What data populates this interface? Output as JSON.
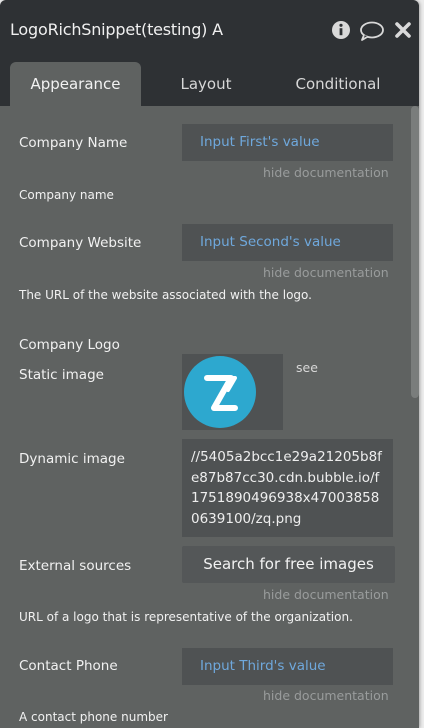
{
  "window": {
    "title": "LogoRichSnippet(testing) A"
  },
  "header_icons": [
    "info-icon",
    "comment-icon",
    "close-icon"
  ],
  "tabs": [
    {
      "label": "Appearance",
      "active": true
    },
    {
      "label": "Layout",
      "active": false
    },
    {
      "label": "Conditional",
      "active": false
    }
  ],
  "fields": {
    "company_name": {
      "label": "Company Name",
      "value": "Input First's value",
      "hide_doc": "hide documentation",
      "description": "Company name"
    },
    "company_website": {
      "label": "Company Website",
      "value": "Input Second's value",
      "hide_doc": "hide documentation",
      "description": "The URL of the website associated with the logo."
    },
    "company_logo": {
      "label": "Company Logo",
      "static_label": "Static image",
      "see_label": "see",
      "dynamic_label": "Dynamic image",
      "dynamic_value": "//5405a2bcc1e29a21205b8fe87b87cc30.cdn.bubble.io/f1751890496938x470038580639100/zq.png",
      "external_label": "External sources",
      "search_button": "Search for free images",
      "hide_doc": "hide documentation",
      "description": "URL of a logo that is representative of the organization."
    },
    "contact_phone": {
      "label": "Contact Phone",
      "value": "Input Third's value",
      "hide_doc": "hide documentation",
      "description": "A contact phone number"
    }
  },
  "colors": {
    "panel": "#5f6261",
    "header": "#2e3134",
    "input_text": "#6fa8dc",
    "logo": "#2da8cf"
  }
}
